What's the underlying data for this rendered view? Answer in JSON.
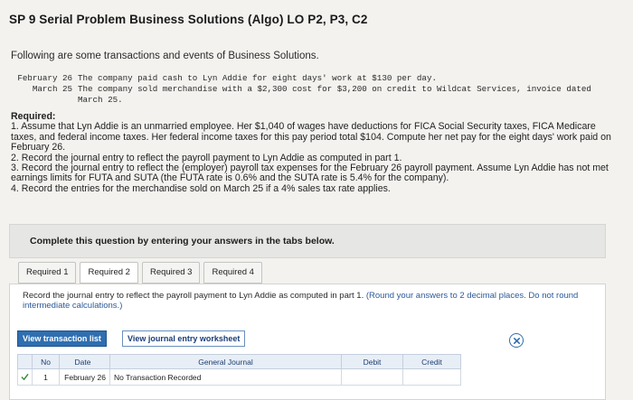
{
  "title": "SP 9 Serial Problem Business Solutions (Algo) LO P2, P3, C2",
  "intro": "Following are some transactions and events of Business Solutions.",
  "events": [
    {
      "date": "February 26",
      "text": "The company paid cash to Lyn Addie for eight days' work at $130 per day."
    },
    {
      "date": "March 25",
      "text": "The company sold merchandise with a $2,300 cost for $3,200 on credit to Wildcat Services, invoice dated",
      "cont": "March 25."
    }
  ],
  "required": {
    "heading": "Required:",
    "items": [
      "1. Assume that Lyn Addie is an unmarried employee. Her $1,040 of wages have deductions for FICA Social Security taxes, FICA Medicare taxes, and federal income taxes. Her federal income taxes for this pay period total $104. Compute her net pay for the eight days' work paid on February 26.",
      "2. Record the journal entry to reflect the payroll payment to Lyn Addie as computed in part 1.",
      "3. Record the journal entry to reflect the (employer) payroll tax expenses for the February 26 payroll payment. Assume Lyn Addie has not met earnings limits for FUTA and SUTA (the FUTA rate is 0.6% and the SUTA rate is 5.4% for the company).",
      "4. Record the entries for the merchandise sold on March 25 if a 4% sales tax rate applies."
    ]
  },
  "panel_text": "Complete this question by entering your answers in the tabs below.",
  "tabs": [
    "Required 1",
    "Required 2",
    "Required 3",
    "Required 4"
  ],
  "active_tab": "Required 2",
  "instruction": "Record the journal entry to reflect the payroll payment to Lyn Addie as computed in part 1.",
  "instruction_note": "(Round your answers to 2 decimal places. Do not round intermediate calculations.)",
  "buttons": {
    "view_transaction_list": "View transaction list",
    "view_journal_worksheet": "View journal entry worksheet"
  },
  "journal": {
    "headers": {
      "no": "No",
      "date": "Date",
      "account": "General Journal",
      "debit": "Debit",
      "credit": "Credit"
    },
    "rows": [
      {
        "no": "1",
        "date": "February 26",
        "account": "No Transaction Recorded",
        "debit": "",
        "credit": ""
      }
    ]
  },
  "colors": {
    "accent": "#2f6fb0",
    "check": "#3a8a3a"
  }
}
